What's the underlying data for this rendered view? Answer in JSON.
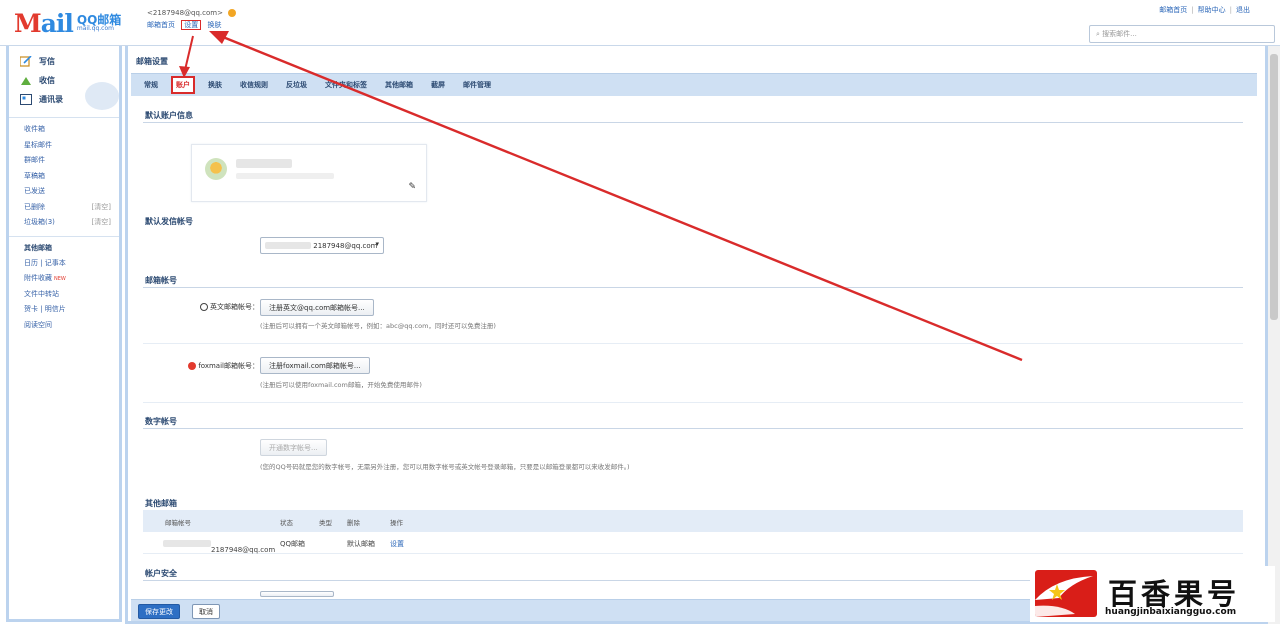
{
  "header": {
    "logo_mail_prefix": "M",
    "logo_mail_rest": "ail",
    "logo_brand": "QQ邮箱",
    "logo_domain": "mail.qq.com",
    "account": "<2187948@qq.com>",
    "sub_links": [
      "邮箱首页",
      "设置",
      "换肤"
    ],
    "top_links": [
      "邮箱首页",
      "帮助中心",
      "退出"
    ],
    "search_placeholder": "搜索邮件..."
  },
  "sidebar": {
    "actions": [
      {
        "label": "写信",
        "icon": "pen-icon"
      },
      {
        "label": "收信",
        "icon": "inbox-icon"
      },
      {
        "label": "通讯录",
        "icon": "contacts-icon"
      }
    ],
    "folders": [
      {
        "label": "收件箱",
        "count": ""
      },
      {
        "label": "星标邮件",
        "count": ""
      },
      {
        "label": "群邮件",
        "count": ""
      },
      {
        "label": "草稿箱",
        "count": ""
      },
      {
        "label": "已发送",
        "count": ""
      },
      {
        "label": "已删除",
        "count": "[清空]"
      },
      {
        "label": "垃圾箱(3)",
        "count": "[清空]"
      }
    ],
    "section_label": "其他邮箱",
    "extras": [
      {
        "label": "日历 | 记事本",
        "badge": ""
      },
      {
        "label": "附件收藏",
        "badge": "NEW"
      },
      {
        "label": "文件中转站",
        "badge": ""
      },
      {
        "label": "贺卡 | 明信片",
        "badge": ""
      },
      {
        "label": "阅读空间",
        "badge": ""
      }
    ]
  },
  "main": {
    "title": "邮箱设置",
    "tabs": [
      "常规",
      "账户",
      "换肤",
      "收信规则",
      "反垃圾",
      "文件夹和标签",
      "其他邮箱",
      "截屏",
      "邮件管理"
    ],
    "active_tab": "账户",
    "sections": {
      "profile": "默认账户信息",
      "send_as": "默认发信帐号",
      "alias": "邮箱帐号",
      "number": "数字帐号",
      "other": "其他邮箱",
      "security": "帐户安全"
    },
    "send_as_value": "2187948@qq.com",
    "alias_rows": [
      {
        "label": "英文邮箱帐号：",
        "button": "注册英文@qq.com邮箱帐号...",
        "hint": "(注册后可以拥有一个英文邮箱帐号，例如：abc@qq.com，同时还可以免费注册)"
      },
      {
        "label": "foxmail邮箱帐号：",
        "button": "注册foxmail.com邮箱帐号...",
        "hint": "(注册后可以使用foxmail.com邮箱，开始免费使用邮件)"
      }
    ],
    "number_button": "开通数字帐号...",
    "number_hint": "(您的QQ号码就是您的数字帐号，无需另外注册，您可以用数字帐号或英文帐号登录邮箱，只要是以邮箱登录都可以来收发邮件。)",
    "other_table": {
      "headers": [
        "邮箱帐号",
        "状态",
        "类型",
        "删除",
        "操作"
      ],
      "rows": [
        {
          "account": "2187948@qq.com",
          "status": "QQ邮箱",
          "type": "默认邮箱",
          "action": "设置"
        }
      ]
    },
    "save_button": "保存更改",
    "cancel_button": "取消"
  },
  "watermark": {
    "title": "百香果号",
    "url": "huangjinbaixiangguo.com"
  },
  "colors": {
    "accent": "#2d6fc4",
    "tab_bar": "#cfe0f3",
    "panel_border": "#bcd3ee",
    "annotation_red": "#d92b2b"
  }
}
